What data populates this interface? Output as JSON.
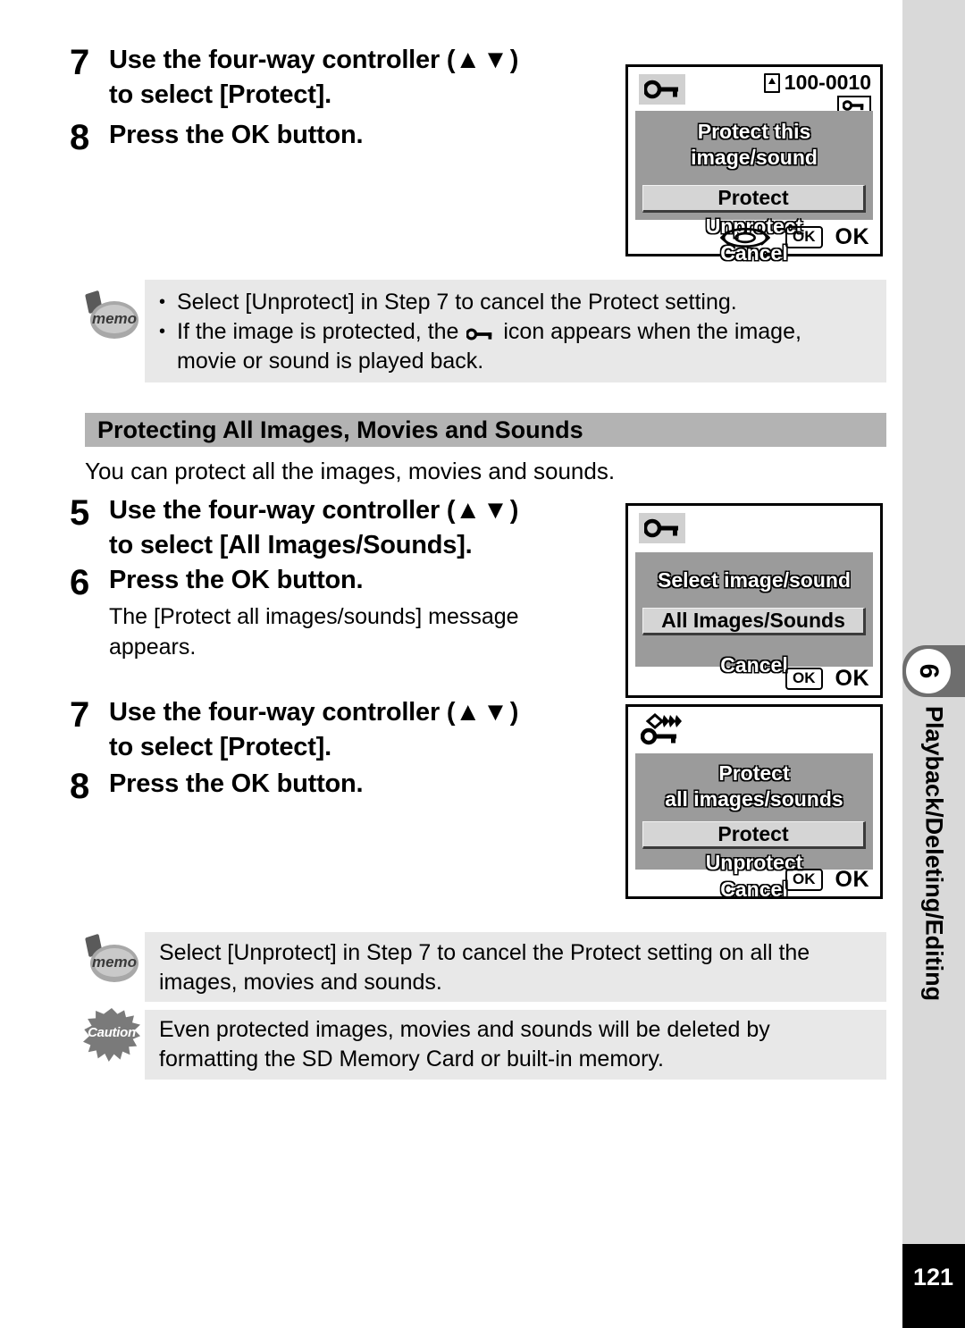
{
  "page": {
    "number": "121",
    "chapter_number": "6",
    "chapter_title": "Playback/Deleting/Editing"
  },
  "steps_top": [
    {
      "number": "7",
      "title_line1": "Use the four-way controller (",
      "arrows": "▲▼",
      "title_line1_end": ")",
      "title_line2": "to select [Protect].",
      "desc": ""
    },
    {
      "number": "8",
      "title_line1": "Press the OK button.",
      "arrows": "",
      "title_line1_end": "",
      "title_line2": "",
      "desc": ""
    }
  ],
  "memo_top": {
    "icon_label": "memo",
    "bullets": [
      "Select [Unprotect] in Step 7 to cancel the Protect setting.",
      "If the image is protected, the  icon appears when the image,",
      "movie or sound is played back."
    ],
    "bullet2_part1": "If the image is protected, the",
    "bullet2_part2": "icon appears when the image,",
    "bullet2_part3": "movie or sound is played back."
  },
  "section": {
    "heading": "Protecting All Images, Movies and Sounds",
    "intro": "You can protect all the images, movies and sounds."
  },
  "steps_mid": [
    {
      "number": "5",
      "title_line1": "Use the four-way controller (",
      "arrows": "▲▼",
      "title_line1_end": ")",
      "title_line2": "to select [All Images/Sounds].",
      "desc": ""
    },
    {
      "number": "6",
      "title_line1": "Press the OK button.",
      "arrows": "",
      "title_line1_end": "",
      "title_line2": "",
      "desc_line1": "The [Protect all images/sounds] message",
      "desc_line2": "appears."
    }
  ],
  "steps_bottom": [
    {
      "number": "7",
      "title_line1": "Use the four-way controller (",
      "arrows": "▲▼",
      "title_line1_end": ")",
      "title_line2": "to select [Protect]."
    },
    {
      "number": "8",
      "title_line1": "Press the OK button.",
      "arrows": "",
      "title_line1_end": "",
      "title_line2": ""
    }
  ],
  "memo_bottom": {
    "icon_label": "memo",
    "line1": "Select [Unprotect] in Step 7 to cancel the Protect setting on all the",
    "line2": "images, movies and sounds."
  },
  "caution_bottom": {
    "icon_label": "Caution",
    "line1": "Even protected images, movies and sounds will be deleted by",
    "line2": "formatting the SD Memory Card or built-in memory."
  },
  "lcd_screens": [
    {
      "id": "protect-single",
      "file_number": "100-0010",
      "header_icon": "key-icon",
      "badge_icon": "key-badge-icon",
      "message": "Protect this image/sound",
      "options": [
        {
          "label": "Protect",
          "selected": true
        },
        {
          "label": "Unprotect",
          "selected": false
        },
        {
          "label": "Cancel",
          "selected": false
        }
      ],
      "footer": {
        "fourway": true,
        "ok_badge": "OK",
        "ok_word": "OK"
      }
    },
    {
      "id": "select-image-sound",
      "file_number": "",
      "header_icon": "key-icon",
      "badge_icon": "",
      "message": "Select image/sound",
      "options": [
        {
          "label": "All Images/Sounds",
          "selected": true
        },
        {
          "label": "Cancel",
          "selected": false
        }
      ],
      "footer": {
        "fourway": false,
        "ok_badge": "OK",
        "ok_word": "OK"
      }
    },
    {
      "id": "protect-all",
      "file_number": "",
      "header_icon": "key-all-images-icon",
      "badge_icon": "",
      "message_line1": "Protect",
      "message_line2": "all images/sounds",
      "options": [
        {
          "label": "Protect",
          "selected": true
        },
        {
          "label": "Unprotect",
          "selected": false
        },
        {
          "label": "Cancel",
          "selected": false
        }
      ],
      "footer": {
        "fourway": false,
        "ok_badge": "OK",
        "ok_word": "OK"
      }
    }
  ],
  "colors": {
    "lcd_panel": "#9b9b9b",
    "lcd_selected": "#d5d5d5",
    "notice_bg": "#e8e8e8",
    "section_band": "#b3b3b3",
    "rail": "#d9d9d9",
    "chapter_block": "#6e6e6e"
  }
}
